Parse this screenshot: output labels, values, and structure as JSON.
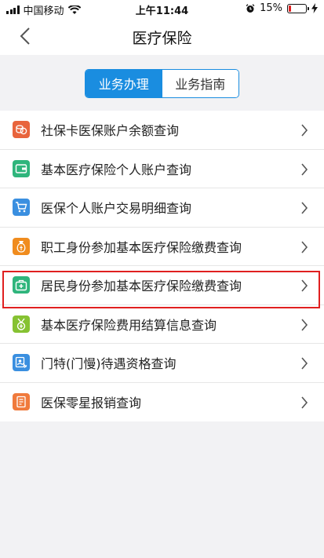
{
  "status_bar": {
    "carrier": "中国移动",
    "time": "上午11:44",
    "battery_percent_text": "15%",
    "battery_level": 0.15
  },
  "nav": {
    "title": "医疗保险"
  },
  "segments": [
    {
      "label": "业务办理",
      "active": true
    },
    {
      "label": "业务指南",
      "active": false
    }
  ],
  "menu": [
    {
      "label": "社保卡医保账户余额查询",
      "icon": "coin-stack-icon",
      "color": "#e8643c"
    },
    {
      "label": "基本医疗保险个人账户查询",
      "icon": "wallet-icon",
      "color": "#2fb57c"
    },
    {
      "label": "医保个人账户交易明细查询",
      "icon": "cart-icon",
      "color": "#3a8fe0"
    },
    {
      "label": "职工身份参加基本医疗保险缴费查询",
      "icon": "money-bag-icon",
      "color": "#f08c1e"
    },
    {
      "label": "居民身份参加基本医疗保险缴费查询",
      "icon": "medical-kit-icon",
      "color": "#2fb57c"
    },
    {
      "label": "基本医疗保险费用结算信息查询",
      "icon": "medal-icon",
      "color": "#86c232"
    },
    {
      "label": "门特(门慢)待遇资格查询",
      "icon": "id-card-icon",
      "color": "#3a8fe0"
    },
    {
      "label": "医保零星报销查询",
      "icon": "receipt-icon",
      "color": "#f07a3c"
    }
  ],
  "colors": {
    "accent": "#1a8de0",
    "highlight": "#e02020",
    "battery_low": "#e02020"
  }
}
